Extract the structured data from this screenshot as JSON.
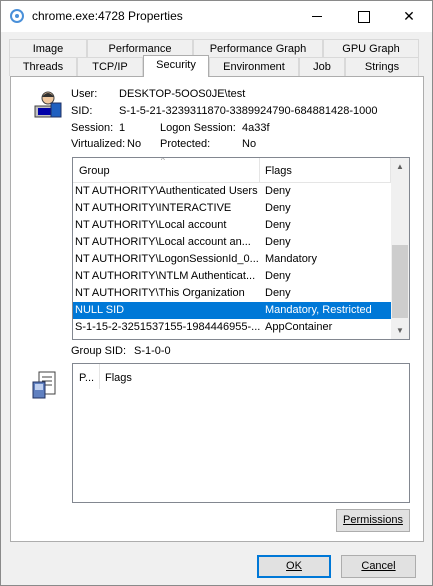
{
  "window": {
    "title": "chrome.exe:4728 Properties",
    "icon": "chrome-icon"
  },
  "tabs_row1": [
    "Image",
    "Performance",
    "Performance Graph",
    "GPU Graph"
  ],
  "tabs_row2": [
    "Threads",
    "TCP/IP",
    "Security",
    "Environment",
    "Job",
    "Strings"
  ],
  "active_tab": "Security",
  "security": {
    "user_label": "User:",
    "user_value": "DESKTOP-5OOS0JE\\test",
    "sid_label": "SID:",
    "sid_value": "S-1-5-21-3239311870-3389924790-684881428-1000",
    "session_label": "Session:",
    "session_value": "1",
    "logon_session_label": "Logon Session:",
    "logon_session_value": "4a33f",
    "virtualized_label": "Virtualized:",
    "virtualized_value": "No",
    "protected_label": "Protected:",
    "protected_value": "No",
    "group_sid_label": "Group SID:",
    "group_sid_value": "S-1-0-0"
  },
  "groups_list": {
    "columns": [
      "Group",
      "Flags"
    ],
    "rows": [
      {
        "group": "NT AUTHORITY\\Authenticated Users",
        "flags": "Deny"
      },
      {
        "group": "NT AUTHORITY\\INTERACTIVE",
        "flags": "Deny"
      },
      {
        "group": "NT AUTHORITY\\Local account",
        "flags": "Deny"
      },
      {
        "group": "NT AUTHORITY\\Local account an...",
        "flags": "Deny"
      },
      {
        "group": "NT AUTHORITY\\LogonSessionId_0...",
        "flags": "Mandatory"
      },
      {
        "group": "NT AUTHORITY\\NTLM Authenticat...",
        "flags": "Deny"
      },
      {
        "group": "NT AUTHORITY\\This Organization",
        "flags": "Deny"
      },
      {
        "group": "NULL SID",
        "flags": "Mandatory, Restricted"
      },
      {
        "group": "S-1-15-2-3251537155-1984446955-...",
        "flags": "AppContainer"
      }
    ],
    "selected_index": 7
  },
  "privileges_list": {
    "columns": [
      "P...",
      "Flags"
    ]
  },
  "buttons": {
    "permissions": "Permissions",
    "ok": "OK",
    "cancel": "Cancel"
  }
}
